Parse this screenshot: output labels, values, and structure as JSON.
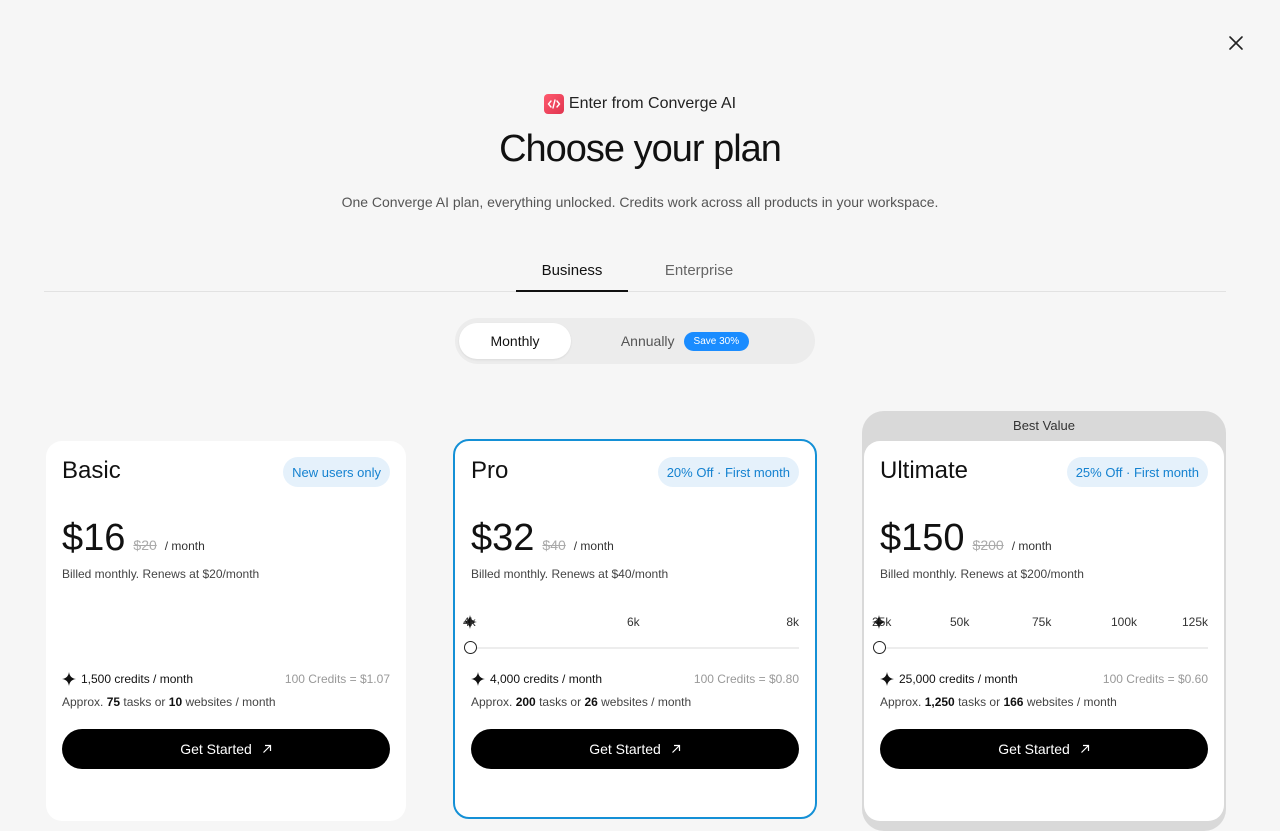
{
  "brand": {
    "text": "Enter from Converge AI",
    "logo_color": "#f0445a"
  },
  "header": {
    "title": "Choose your plan",
    "subtitle": "One Converge AI plan, everything unlocked. Credits work across all products in your workspace."
  },
  "tabs": [
    {
      "label": "Business",
      "active": true
    },
    {
      "label": "Enterprise",
      "active": false
    }
  ],
  "billing_toggle": {
    "monthly": "Monthly",
    "annually": "Annually",
    "save_badge": "Save 30%",
    "selected": "Monthly"
  },
  "plans": [
    {
      "name": "Basic",
      "badge": "New users only",
      "price": "$16",
      "old_price": "$20",
      "per": "/ month",
      "billed": "Billed monthly. Renews at $20/month",
      "credits": "1,500 credits / month",
      "rate": "100 Credits = $1.07",
      "approx_prefix": "Approx.",
      "tasks": "75",
      "tasks_sep": "tasks or",
      "websites": "10",
      "websites_suffix": "websites / month",
      "cta": "Get Started"
    },
    {
      "name": "Pro",
      "badge": "20% Off · First month",
      "price": "$32",
      "old_price": "$40",
      "per": "/ month",
      "billed": "Billed monthly. Renews at $40/month",
      "slider_ticks": [
        "4k",
        "6k",
        "8k"
      ],
      "slider_value": "4k",
      "credits": "4,000 credits / month",
      "rate": "100 Credits = $0.80",
      "approx_prefix": "Approx.",
      "tasks": "200",
      "tasks_sep": "tasks or",
      "websites": "26",
      "websites_suffix": "websites / month",
      "cta": "Get Started"
    },
    {
      "name": "Ultimate",
      "ribbon": "Best Value",
      "badge": "25% Off · First month",
      "price": "$150",
      "old_price": "$200",
      "per": "/ month",
      "billed": "Billed monthly. Renews at $200/month",
      "slider_ticks": [
        "25k",
        "50k",
        "75k",
        "100k",
        "125k"
      ],
      "slider_value": "25k",
      "credits": "25,000 credits / month",
      "rate": "100 Credits = $0.60",
      "approx_prefix": "Approx.",
      "tasks": "1,250",
      "tasks_sep": "tasks or",
      "websites": "166",
      "websites_suffix": "websites / month",
      "cta": "Get Started"
    }
  ],
  "colors": {
    "accent": "#1490d6",
    "badge_bg": "#e5f1fb",
    "save_badge": "#1a8cff",
    "cta": "#000000"
  }
}
